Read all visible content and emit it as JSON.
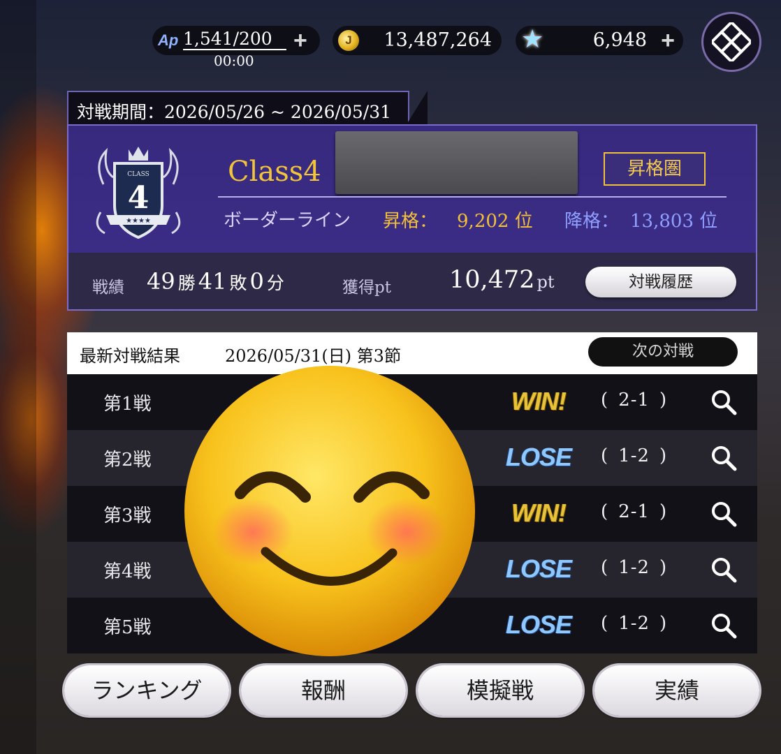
{
  "status_bar": {
    "ap_icon": "Ap",
    "ap_value": "1,541/200",
    "ap_timer": "00:00",
    "gold_value": "13,487,264",
    "star_value": "6,948"
  },
  "season": {
    "period": "対戦期間：2026/05/26 ~ 2026/05/31",
    "class_number": "4",
    "class_name": "Class4",
    "zone_badge": "昇格圏",
    "border_label": "ボーダーライン",
    "promotion_label": "昇格：",
    "promotion_rank": "9,202 位",
    "demotion_label": "降格：",
    "demotion_rank": "13,803 位",
    "record_label": "戦績",
    "wins": "49",
    "wins_unit": "勝",
    "losses": "41",
    "losses_unit": "敗",
    "draws": "0",
    "draws_unit": "分",
    "points_label": "獲得pt",
    "points_value": "10,472",
    "points_unit": "pt",
    "history_button": "対戦履歴"
  },
  "results": {
    "title": "最新対戦結果",
    "date": "2026/05/31(日) 第3節",
    "next_button": "次の対戦",
    "rows": [
      {
        "label": "第1戦",
        "result": "WIN!",
        "score": "2-1"
      },
      {
        "label": "第2戦",
        "result": "LOSE",
        "score": "1-2"
      },
      {
        "label": "第3戦",
        "result": "WIN!",
        "score": "2-1"
      },
      {
        "label": "第4戦",
        "result": "LOSE",
        "score": "1-2"
      },
      {
        "label": "第5戦",
        "result": "LOSE",
        "score": "1-2"
      }
    ]
  },
  "bottom_tabs": [
    "ランキング",
    "報酬",
    "模擬戦",
    "実績"
  ],
  "colors": {
    "panel": "#37297e",
    "gold_text": "#f2c43a",
    "win": "#e8c33a",
    "lose": "#8ec8ff"
  },
  "icons": {
    "ap": "ap-icon",
    "gold": "coin-icon",
    "star": "star-icon",
    "menu": "knot-menu-icon",
    "inspect": "magnifier-icon",
    "overlay": "smiling-face-emoji"
  }
}
